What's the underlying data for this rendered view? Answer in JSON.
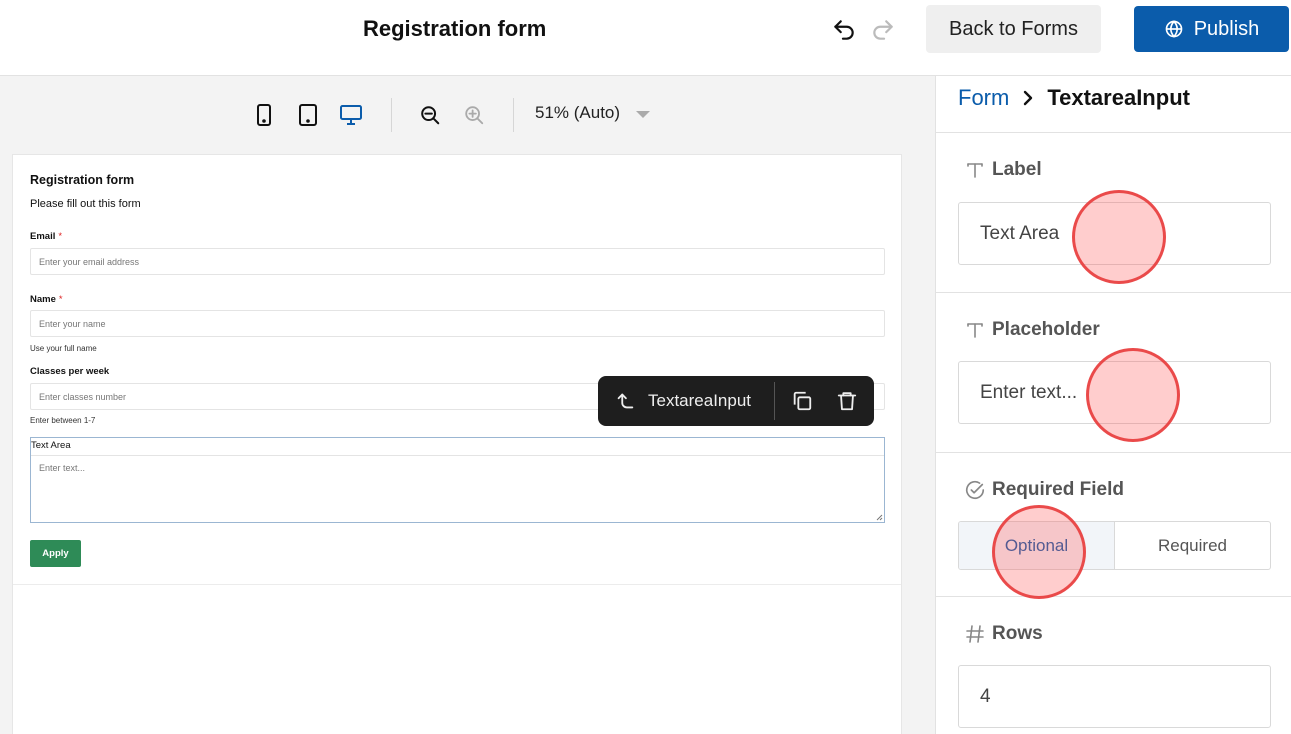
{
  "header": {
    "title": "Registration form",
    "back_label": "Back to Forms",
    "publish_label": "Publish"
  },
  "canvas": {
    "zoom_label": "51% (Auto)"
  },
  "form": {
    "title": "Registration form",
    "description": "Please fill out this form",
    "fields": [
      {
        "label": "Email",
        "required_mark": "*",
        "placeholder": "Enter your email address"
      },
      {
        "label": "Name",
        "required_mark": "*",
        "placeholder": "Enter your name",
        "help": "Use your full name"
      },
      {
        "label": "Classes per week",
        "placeholder": "Enter classes number",
        "help": "Enter between 1-7"
      }
    ],
    "textarea": {
      "label": "Text Area",
      "placeholder": "Enter text..."
    },
    "apply_label": "Apply"
  },
  "floating_toolbar": {
    "parent_label": "TextareaInput"
  },
  "panel": {
    "breadcrumb": {
      "root": "Form",
      "current": "TextareaInput"
    },
    "label_section": {
      "title": "Label",
      "value": "Text Area"
    },
    "placeholder_section": {
      "title": "Placeholder",
      "value": "Enter text..."
    },
    "required_section": {
      "title": "Required Field",
      "options": [
        "Optional",
        "Required"
      ],
      "selected": "Optional"
    },
    "rows_section": {
      "title": "Rows",
      "value": "4"
    }
  },
  "colors": {
    "primary": "#0b5cab",
    "apply_green": "#2e8b57",
    "required_star": "#dd2222",
    "toolbar_dark": "#1e1e1e",
    "click_marker": "#e83c3c"
  }
}
